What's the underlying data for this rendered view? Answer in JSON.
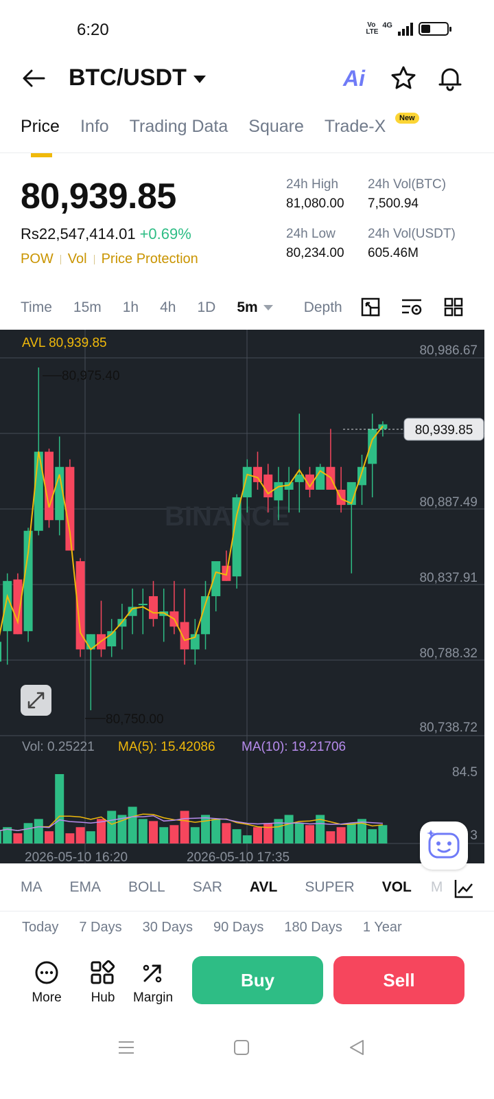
{
  "status": {
    "time": "6:20",
    "network": "4G",
    "volte": "Vo LTE",
    "signal_bars": 4,
    "battery_level": 0.35
  },
  "header": {
    "pair": "BTC/USDT",
    "ai_icon": "Ai"
  },
  "tabs": [
    {
      "label": "Price",
      "active": true
    },
    {
      "label": "Info"
    },
    {
      "label": "Trading Data"
    },
    {
      "label": "Square"
    },
    {
      "label": "Trade-X",
      "badge": "New"
    }
  ],
  "price": {
    "last": "80,939.85",
    "fiat": "Rs22,547,414.01",
    "change": "+0.69%",
    "tags": [
      "POW",
      "Vol",
      "Price Protection"
    ]
  },
  "stats": {
    "high_label": "24h High",
    "high": "81,080.00",
    "vol_btc_label": "24h Vol(BTC)",
    "vol_btc": "7,500.94",
    "low_label": "24h Low",
    "low": "80,234.00",
    "vol_usdt_label": "24h Vol(USDT)",
    "vol_usdt": "605.46M"
  },
  "intervals": [
    "Time",
    "15m",
    "1h",
    "4h",
    "1D"
  ],
  "interval_selected": "5m",
  "depth_label": "Depth",
  "chart": {
    "avl_label": "AVL 80,939.85",
    "y_ticks": [
      "80,986.67",
      "80,887.49",
      "80,837.91",
      "80,788.32",
      "80,738.72"
    ],
    "current_price": "80,939.85",
    "high_marker": "80,975.40",
    "low_marker": "80,750.00",
    "vol_label": "Vol: 0.25221",
    "ma5_label": "MA(5): 15.42086",
    "ma10_label": "MA(10): 19.21706",
    "vol_tick": "84.5",
    "vol_tick_low": "3",
    "x_labels": [
      "2026-05-10 16:20",
      "2026-05-10 17:35"
    ],
    "watermark": "BINANCE",
    "colors": {
      "up": "#2ebd85",
      "down": "#f6465d",
      "avl": "#f0b90b",
      "ma10": "#b78ced",
      "bg": "#1e2329"
    }
  },
  "indicators": [
    "MA",
    "EMA",
    "BOLL",
    "SAR",
    "AVL",
    "SUPER"
  ],
  "indicators_on": [
    "AVL"
  ],
  "sub_indicator": "VOL",
  "sub_indicator_next": "M",
  "periods": [
    "Today",
    "7 Days",
    "30 Days",
    "90 Days",
    "180 Days",
    "1 Year"
  ],
  "actions": {
    "more": "More",
    "hub": "Hub",
    "margin": "Margin",
    "buy": "Buy",
    "sell": "Sell"
  }
}
